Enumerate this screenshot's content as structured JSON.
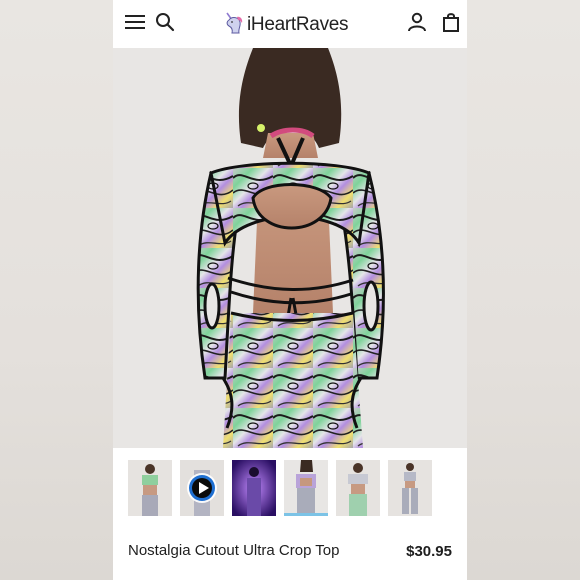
{
  "brand": {
    "name": "iHeartRaves"
  },
  "header": {
    "icons": [
      "menu-icon",
      "search-icon",
      "account-icon",
      "cart-icon"
    ]
  },
  "product": {
    "title": "Nostalgia Cutout Ultra Crop Top",
    "price": "$30.95"
  },
  "gallery": {
    "thumbnails": [
      {
        "kind": "image"
      },
      {
        "kind": "video"
      },
      {
        "kind": "image"
      },
      {
        "kind": "image",
        "selected": true
      },
      {
        "kind": "image"
      },
      {
        "kind": "image"
      }
    ]
  },
  "colors": {
    "selected_indicator": "#7cc3e6",
    "text": "#1e1e1e"
  }
}
